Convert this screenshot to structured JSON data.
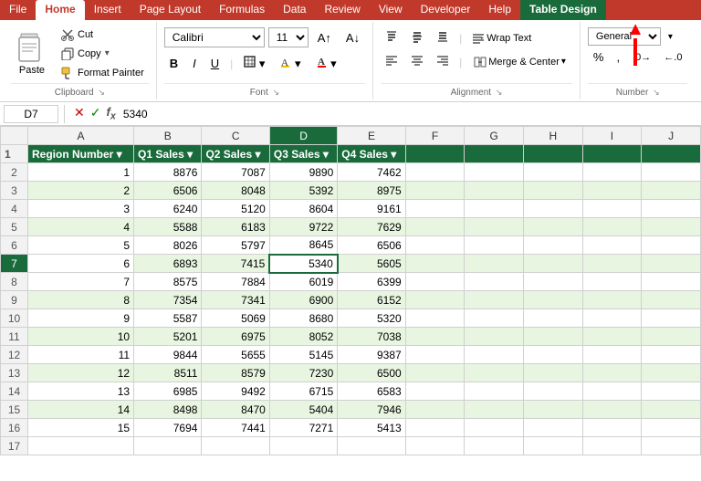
{
  "menubar": {
    "tabs": [
      "File",
      "Home",
      "Insert",
      "Page Layout",
      "Formulas",
      "Data",
      "Review",
      "View",
      "Developer",
      "Help",
      "Table Design"
    ],
    "active_tab": "Home",
    "table_design_tab": "Table Design"
  },
  "ribbon": {
    "clipboard": {
      "label": "Clipboard",
      "paste_label": "Paste",
      "cut_label": "Cut",
      "copy_label": "Copy",
      "format_painter_label": "Format Painter"
    },
    "font": {
      "label": "Font",
      "font_name": "Calibri",
      "font_size": "11",
      "bold_label": "B",
      "italic_label": "I",
      "underline_label": "U"
    },
    "alignment": {
      "label": "Alignment",
      "wrap_text_label": "Wrap Text",
      "merge_label": "Merge & Center"
    },
    "number": {
      "label": "Number",
      "format_label": "General"
    }
  },
  "formula_bar": {
    "cell_ref": "D7",
    "formula_value": "5340"
  },
  "columns": {
    "row_header": "",
    "col_a": "A",
    "col_b": "B",
    "col_c": "C",
    "col_d": "D",
    "col_e": "E",
    "col_f": "F",
    "col_g": "G",
    "col_h": "H",
    "col_i": "I",
    "col_j": "J"
  },
  "table_headers": {
    "col_a": "Region Number",
    "col_b": "Q1 Sales",
    "col_c": "Q2 Sales",
    "col_d": "Q3 Sales",
    "col_e": "Q4 Sales"
  },
  "rows": [
    {
      "row": 2,
      "a": 1,
      "b": 8876,
      "c": 7087,
      "d": 9890,
      "e": 7462
    },
    {
      "row": 3,
      "a": 2,
      "b": 6506,
      "c": 8048,
      "d": 5392,
      "e": 8975
    },
    {
      "row": 4,
      "a": 3,
      "b": 6240,
      "c": 5120,
      "d": 8604,
      "e": 9161
    },
    {
      "row": 5,
      "a": 4,
      "b": 5588,
      "c": 6183,
      "d": 9722,
      "e": 7629
    },
    {
      "row": 6,
      "a": 5,
      "b": 8026,
      "c": 5797,
      "d": 8645,
      "e": 6506
    },
    {
      "row": 7,
      "a": 6,
      "b": 6893,
      "c": 7415,
      "d": 5340,
      "e": 5605,
      "selected": true
    },
    {
      "row": 8,
      "a": 7,
      "b": 8575,
      "c": 7884,
      "d": 6019,
      "e": 6399
    },
    {
      "row": 9,
      "a": 8,
      "b": 7354,
      "c": 7341,
      "d": 6900,
      "e": 6152
    },
    {
      "row": 10,
      "a": 9,
      "b": 5587,
      "c": 5069,
      "d": 8680,
      "e": 5320
    },
    {
      "row": 11,
      "a": 10,
      "b": 5201,
      "c": 6975,
      "d": 8052,
      "e": 7038
    },
    {
      "row": 12,
      "a": 11,
      "b": 9844,
      "c": 5655,
      "d": 5145,
      "e": 9387
    },
    {
      "row": 13,
      "a": 12,
      "b": 8511,
      "c": 8579,
      "d": 7230,
      "e": 6500
    },
    {
      "row": 14,
      "a": 13,
      "b": 6985,
      "c": 9492,
      "d": 6715,
      "e": 6583
    },
    {
      "row": 15,
      "a": 14,
      "b": 8498,
      "c": 8470,
      "d": 5404,
      "e": 7946
    },
    {
      "row": 16,
      "a": 15,
      "b": 7694,
      "c": 7441,
      "d": 7271,
      "e": 5413
    }
  ],
  "empty_rows": [
    17
  ]
}
